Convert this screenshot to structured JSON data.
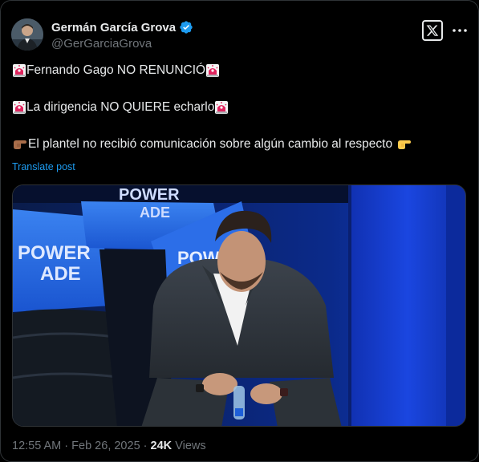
{
  "author": {
    "display_name": "Germán García Grova",
    "handle": "@GerGarciaGrova",
    "verified": true
  },
  "icons": {
    "verified": "verified-badge-icon",
    "x_logo": "x-logo-icon",
    "more": "more-options-icon",
    "siren": "police-car-light-emoji",
    "hand": "backhand-index-pointing-right-emoji"
  },
  "post": {
    "lines": [
      "Fernando Gago NO RENUNCIÓ",
      "La dirigencia NO QUIERE echarlo",
      "El plantel no recibió comunicación sobre algún cambio al respecto"
    ],
    "translate_label": "Translate post"
  },
  "media": {
    "banner_texts": [
      "POWER",
      "ADE",
      "POWER",
      "ADE",
      "POW"
    ]
  },
  "meta": {
    "time": "12:55 AM",
    "separator": "·",
    "date": "Feb 26, 2025",
    "views_count": "24K",
    "views_label": "Views"
  },
  "colors": {
    "background": "#000000",
    "text": "#e7e9ea",
    "muted": "#71767b",
    "link": "#1d9bf0",
    "verified": "#1d9bf0",
    "siren_red": "#e0245e"
  }
}
